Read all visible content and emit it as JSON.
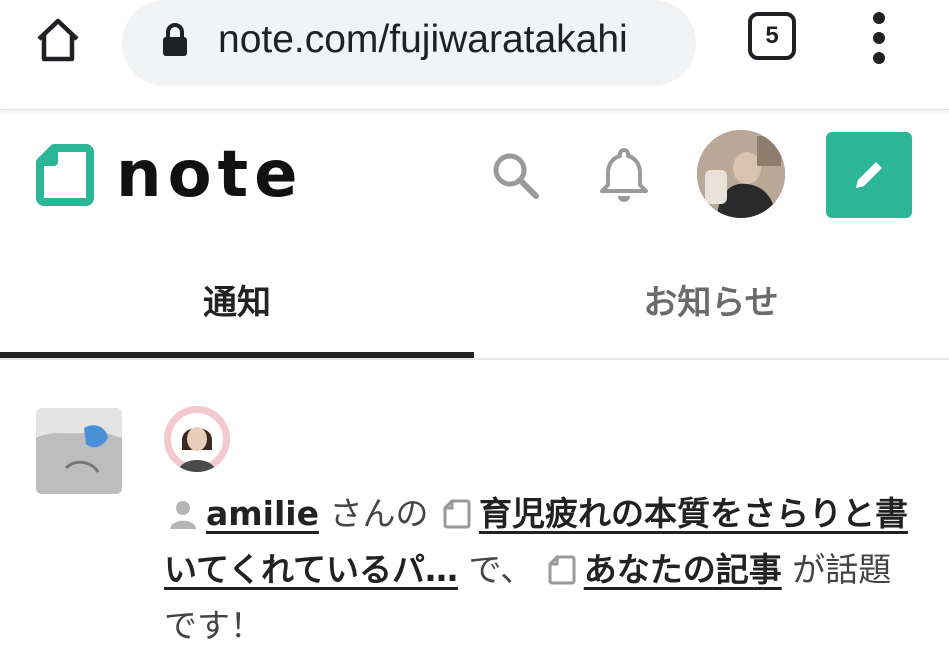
{
  "browser": {
    "url": "note.com/fujiwaratakahi",
    "tab_count": "5"
  },
  "header": {
    "logo_text": "note",
    "brand_color": "#2cb696"
  },
  "tabs": [
    {
      "label": "通知",
      "active": true
    },
    {
      "label": "お知らせ",
      "active": false
    }
  ],
  "notification": {
    "user_name": "amilie",
    "san_no": "さんの",
    "article_title": "育児疲れの本質をさらりと書いてくれているパ…",
    "de": "で、",
    "your_article": "あなたの記事",
    "suffix": "が話題です！"
  },
  "icons": {
    "home": "home-icon",
    "lock": "lock-icon",
    "menu": "more-vert-icon",
    "search": "search-icon",
    "bell": "bell-icon",
    "pen": "pencil-icon",
    "person": "person-icon",
    "note": "note-icon"
  }
}
